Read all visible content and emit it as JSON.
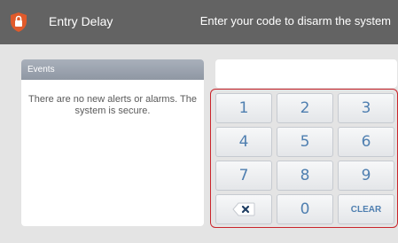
{
  "header": {
    "title": "Entry Delay",
    "instruction": "Enter your code to disarm the system",
    "icon": "alarm-shield-icon",
    "icon_color": "#e05a2b",
    "background": "#636363"
  },
  "events": {
    "title": "Events",
    "message": "There are no new alerts or alarms. The system is secure."
  },
  "code_display": {
    "value": ""
  },
  "keypad": {
    "border_color": "#c9242b",
    "keys": {
      "k1": "1",
      "k2": "2",
      "k3": "3",
      "k4": "4",
      "k5": "5",
      "k6": "6",
      "k7": "7",
      "k8": "8",
      "k9": "9",
      "k0": "0",
      "backspace_icon": "backspace-icon",
      "clear": "CLEAR"
    }
  }
}
